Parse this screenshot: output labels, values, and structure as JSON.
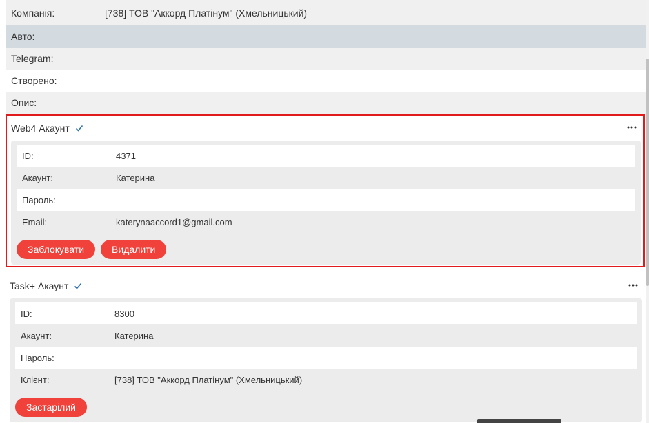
{
  "properties": [
    {
      "label": "Компанія:",
      "value": "[738] ТОВ \"Аккорд Платінум\" (Хмельницький)"
    },
    {
      "label": "Авто:",
      "value": ""
    },
    {
      "label": "Telegram:",
      "value": ""
    },
    {
      "label": "Створено:",
      "value": ""
    },
    {
      "label": "Опис:",
      "value": ""
    }
  ],
  "web4": {
    "title": "Web4 Акаунт",
    "fields": [
      {
        "label": "ID:",
        "value": "4371"
      },
      {
        "label": "Акаунт:",
        "value": "Катерина"
      },
      {
        "label": "Пароль:",
        "value": ""
      },
      {
        "label": "Email:",
        "value": "katerynaaccord1@gmail.com"
      }
    ],
    "buttons": {
      "block": "Заблокувати",
      "delete": "Видалити"
    }
  },
  "taskplus": {
    "title": "Task+ Акаунт",
    "fields": [
      {
        "label": "ID:",
        "value": "8300"
      },
      {
        "label": "Акаунт:",
        "value": "Катерина"
      },
      {
        "label": "Пароль:",
        "value": ""
      },
      {
        "label": "Клієнт:",
        "value": "[738] ТОВ \"Аккорд Платінум\" (Хмельницький)"
      }
    ],
    "buttons": {
      "outdated": "Застарілий"
    }
  },
  "colors": {
    "accent_red": "#f0413a",
    "highlight_border": "#e11b1b",
    "check_blue": "#2a6fb0",
    "row_blue": "#d3dae0"
  }
}
